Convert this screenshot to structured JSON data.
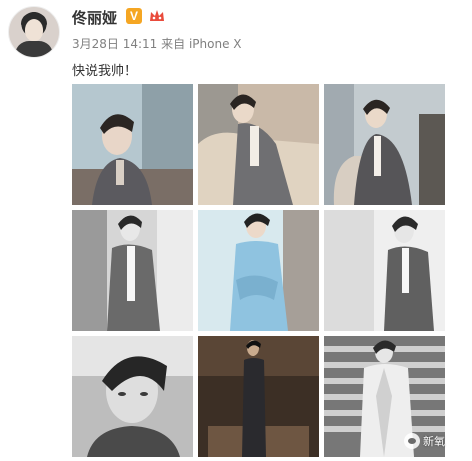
{
  "post": {
    "author": "佟丽娅",
    "verified_mark": "V",
    "date": "3月28日 14:11",
    "source": "来自 iPhone X",
    "text": "快说我帅！"
  },
  "icons": {
    "avatar": "user-avatar",
    "verified": "verified-badge-icon",
    "member": "vip-crown-icon"
  },
  "colors": {
    "verified": "#f5a623",
    "meta": "#808080",
    "text": "#333333"
  },
  "photos": [
    {
      "name": "photo-1",
      "tone": "color"
    },
    {
      "name": "photo-2",
      "tone": "color"
    },
    {
      "name": "photo-3",
      "tone": "color"
    },
    {
      "name": "photo-4",
      "tone": "bw"
    },
    {
      "name": "photo-5",
      "tone": "blue"
    },
    {
      "name": "photo-6",
      "tone": "bw"
    },
    {
      "name": "photo-7",
      "tone": "bw"
    },
    {
      "name": "photo-8",
      "tone": "dark"
    },
    {
      "name": "photo-9",
      "tone": "bw"
    }
  ],
  "watermark": {
    "text": "新氧"
  }
}
